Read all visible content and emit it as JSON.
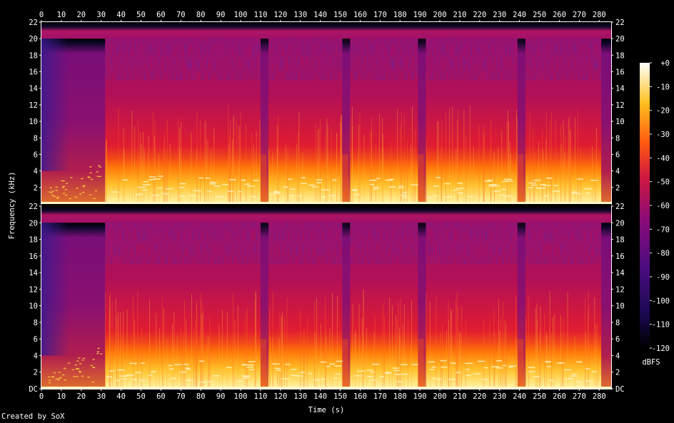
{
  "chart_data": {
    "type": "heatmap",
    "channels": 2,
    "xlabel": "Time (s)",
    "ylabel": "Frequency (kHz)",
    "colorbar_label": "dBFS",
    "xlim": [
      0,
      286
    ],
    "x_ticks": [
      "0",
      "10",
      "20",
      "30",
      "40",
      "50",
      "60",
      "70",
      "80",
      "90",
      "100",
      "110",
      "120",
      "130",
      "140",
      "150",
      "160",
      "170",
      "180",
      "190",
      "200",
      "210",
      "220",
      "230",
      "240",
      "250",
      "260",
      "270",
      "280"
    ],
    "ylim_khz": [
      0,
      22
    ],
    "y_ticks_top": [
      "22",
      "20",
      "18",
      "16",
      "14",
      "12",
      "10",
      "8",
      "6",
      "4",
      "2"
    ],
    "y_ticks_bottom": [
      "22",
      "20",
      "18",
      "16",
      "14",
      "12",
      "10",
      "8",
      "6",
      "4",
      "2",
      "DC"
    ],
    "zlim_dbfs": [
      -120,
      0
    ],
    "colorbar_ticks": [
      "+0",
      "-10",
      "-20",
      "-30",
      "-40",
      "-50",
      "-60",
      "-70",
      "-80",
      "-90",
      "-100",
      "-110",
      "-120"
    ],
    "energy_cutoff_khz": 20,
    "section_boundaries_s": [
      0,
      32,
      110,
      114,
      151,
      155,
      189,
      193,
      239,
      243,
      281,
      286
    ],
    "grid": false,
    "colormap": [
      "#000000",
      "#2a0a6e",
      "#6a0c8a",
      "#b0105e",
      "#e8202a",
      "#ff7a00",
      "#ffd21e",
      "#ffffff"
    ]
  },
  "footer": {
    "credit": "Created by SoX"
  }
}
